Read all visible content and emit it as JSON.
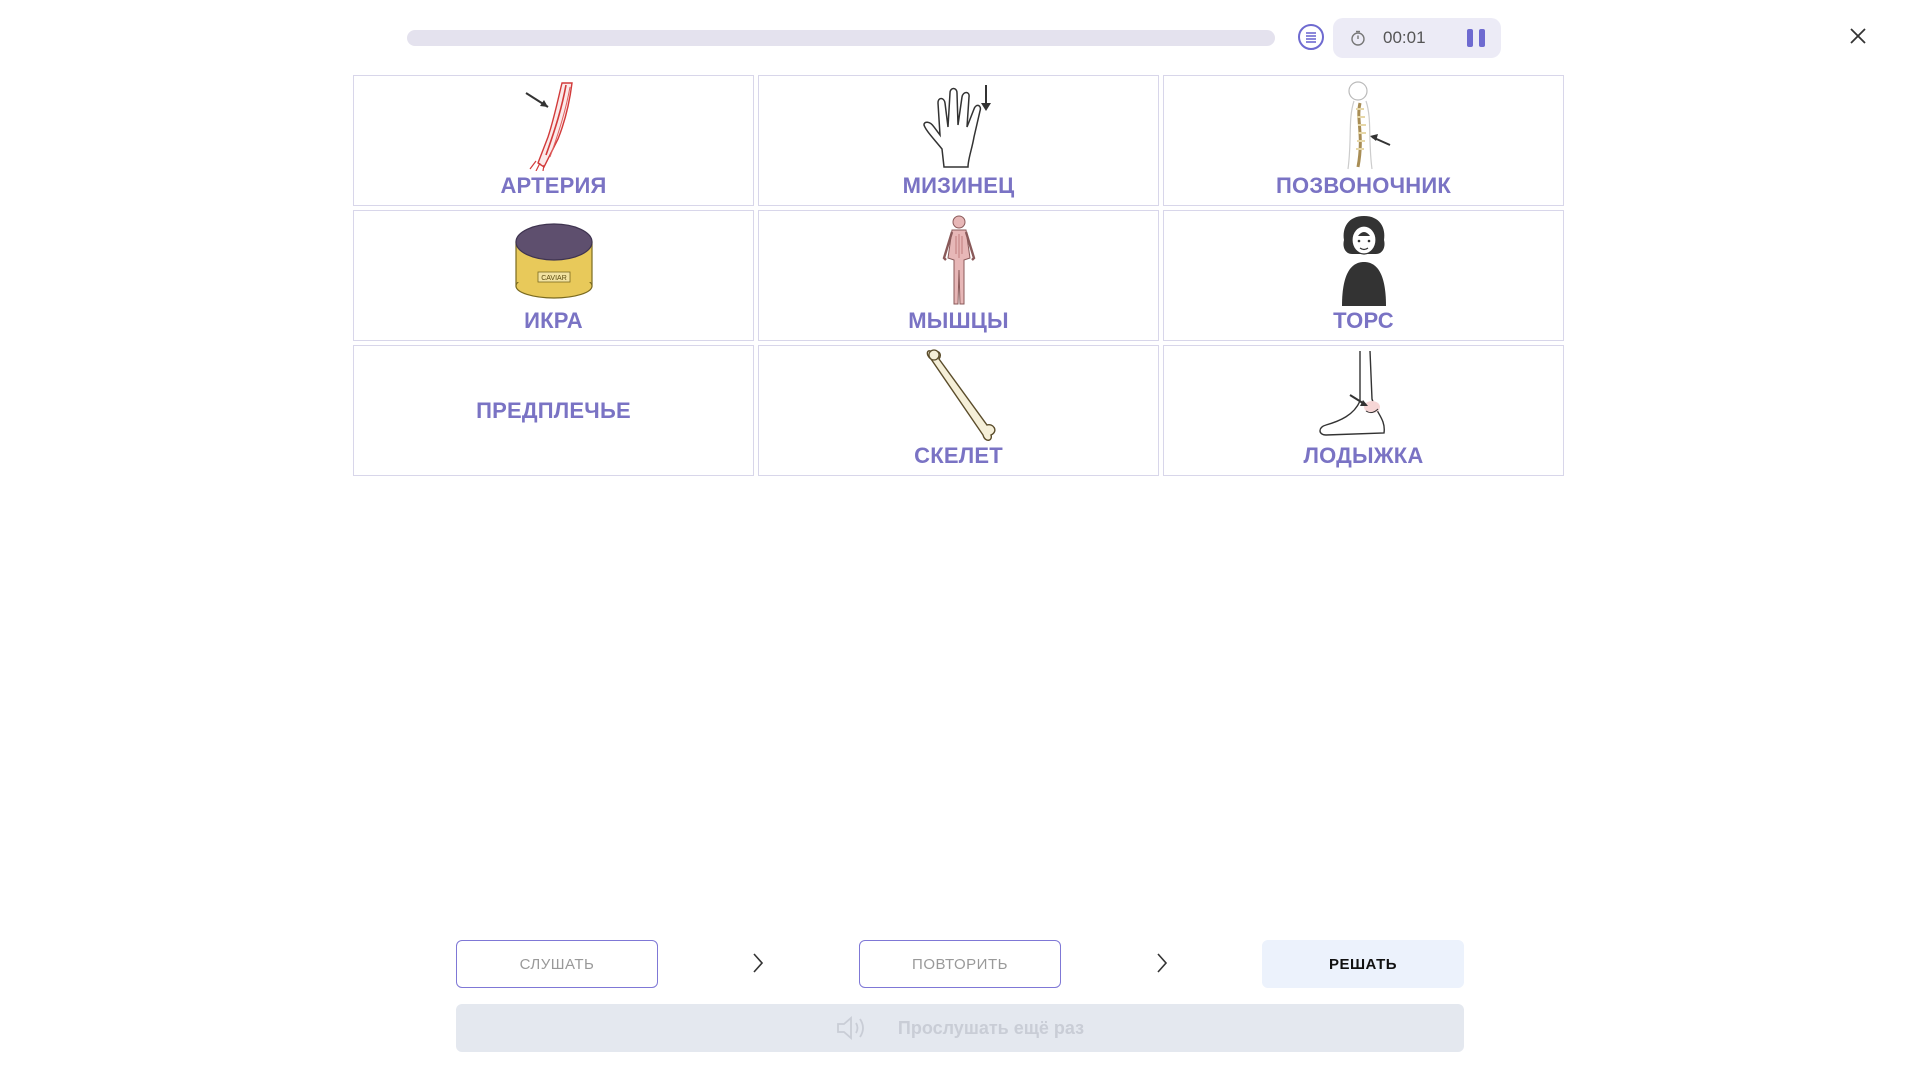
{
  "progress": {
    "fraction": 0.0
  },
  "timer": {
    "time": "00:01",
    "icon": "stopwatch-icon",
    "pause_icon": "pause-icon"
  },
  "top_icons": {
    "list": "list-icon",
    "close": "close-icon"
  },
  "grid": {
    "cells": [
      {
        "word": "АРТЕРИЯ",
        "icon": "arm-artery-icon"
      },
      {
        "word": "МИЗИНЕЦ",
        "icon": "hand-pinky-icon"
      },
      {
        "word": "ПОЗВОНОЧНИК",
        "icon": "spine-icon"
      },
      {
        "word": "ИКРА",
        "icon": "caviar-tin-icon",
        "icon_text": "CAVIAR"
      },
      {
        "word": "МЫШЦЫ",
        "icon": "muscles-figure-icon"
      },
      {
        "word": "ТОРС",
        "icon": "torso-icon"
      },
      {
        "word": "ПРЕДПЛЕЧЬЕ",
        "icon": null
      },
      {
        "word": "СКЕЛЕТ",
        "icon": "bone-icon"
      },
      {
        "word": "ЛОДЫЖКА",
        "icon": "foot-ankle-icon"
      }
    ]
  },
  "steps": {
    "listen": "СЛУШАТЬ",
    "repeat": "ПОВТОРИТЬ",
    "solve": "РЕШАТЬ"
  },
  "replay": {
    "label": "Прослушать ещё раз",
    "icon": "speaker-icon"
  },
  "colors": {
    "accent": "#6e6ad0",
    "word": "#7a73c4",
    "cell_border": "#d8d6ea",
    "solve_bg": "#ecf2fc",
    "replay_bg": "#e4e8ef"
  }
}
